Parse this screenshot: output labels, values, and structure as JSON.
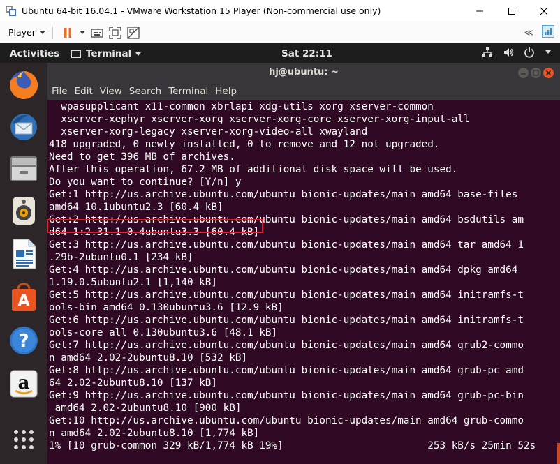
{
  "window": {
    "title": "Ubuntu 64-bit 16.04.1 - VMware Workstation 15 Player (Non-commercial use only)",
    "controls": [
      "minimize-icon",
      "maximize-icon",
      "close-icon"
    ]
  },
  "vm_toolbar": {
    "player_label": "Player",
    "icons": [
      "pause-icon",
      "pause-dropdown-icon",
      "send-ctrl-alt-del-icon",
      "fullscreen-icon",
      "unity-icon"
    ],
    "right_icons": [
      "collapse-toolbar-icon",
      "vmware-notification-icon"
    ],
    "collapse_label": "≪"
  },
  "ubuntu_topbar": {
    "activities": "Activities",
    "app_menu": "Terminal",
    "clock": "Sat 22:11",
    "tray_icons": [
      "network-icon",
      "volume-icon",
      "power-icon"
    ]
  },
  "dock": {
    "items": [
      "firefox-icon",
      "thunderbird-icon",
      "files-icon",
      "rhythmbox-icon",
      "libreoffice-writer-icon",
      "ubuntu-software-icon",
      "help-icon",
      "amazon-icon",
      "show-applications-icon"
    ]
  },
  "terminal": {
    "title": "hj@ubuntu: ~",
    "menu": [
      "File",
      "Edit",
      "View",
      "Search",
      "Terminal",
      "Help"
    ],
    "lines": [
      "  wpasupplicant x11-common xbrlapi xdg-utils xorg xserver-common",
      "  xserver-xephyr xserver-xorg xserver-xorg-core xserver-xorg-input-all",
      "  xserver-xorg-legacy xserver-xorg-video-all xwayland",
      "418 upgraded, 0 newly installed, 0 to remove and 12 not upgraded.",
      "Need to get 396 MB of archives.",
      "After this operation, 67.2 MB of additional disk space will be used.",
      "Do you want to continue? [Y/n] y",
      "Get:1 http://us.archive.ubuntu.com/ubuntu bionic-updates/main amd64 base-files",
      "amd64 10.1ubuntu2.3 [60.4 kB]",
      "Get:2 http://us.archive.ubuntu.com/ubuntu bionic-updates/main amd64 bsdutils am",
      "d64 1:2.31.1-0.4ubuntu3.3 [60.4 kB]",
      "Get:3 http://us.archive.ubuntu.com/ubuntu bionic-updates/main amd64 tar amd64 1",
      ".29b-2ubuntu0.1 [234 kB]",
      "Get:4 http://us.archive.ubuntu.com/ubuntu bionic-updates/main amd64 dpkg amd64",
      "1.19.0.5ubuntu2.1 [1,140 kB]",
      "Get:5 http://us.archive.ubuntu.com/ubuntu bionic-updates/main amd64 initramfs-t",
      "ools-bin amd64 0.130ubuntu3.6 [12.9 kB]",
      "Get:6 http://us.archive.ubuntu.com/ubuntu bionic-updates/main amd64 initramfs-t",
      "ools-core all 0.130ubuntu3.6 [48.1 kB]",
      "Get:7 http://us.archive.ubuntu.com/ubuntu bionic-updates/main amd64 grub2-commo",
      "n amd64 2.02-2ubuntu8.10 [532 kB]",
      "Get:8 http://us.archive.ubuntu.com/ubuntu bionic-updates/main amd64 grub-pc amd",
      "64 2.02-2ubuntu8.10 [137 kB]",
      "Get:9 http://us.archive.ubuntu.com/ubuntu bionic-updates/main amd64 grub-pc-bin",
      " amd64 2.02-2ubuntu8.10 [900 kB]",
      "Get:10 http://us.archive.ubuntu.com/ubuntu bionic-updates/main amd64 grub-commo",
      "n amd64 2.02-2ubuntu8.10 [1,774 kB]",
      "1% [10 grub-common 329 kB/1,774 kB 19%]                        253 kB/s 25min 52s"
    ],
    "highlighted_line_index": 6,
    "highlight_color": "#e3202a",
    "background_color": "#300a24"
  }
}
